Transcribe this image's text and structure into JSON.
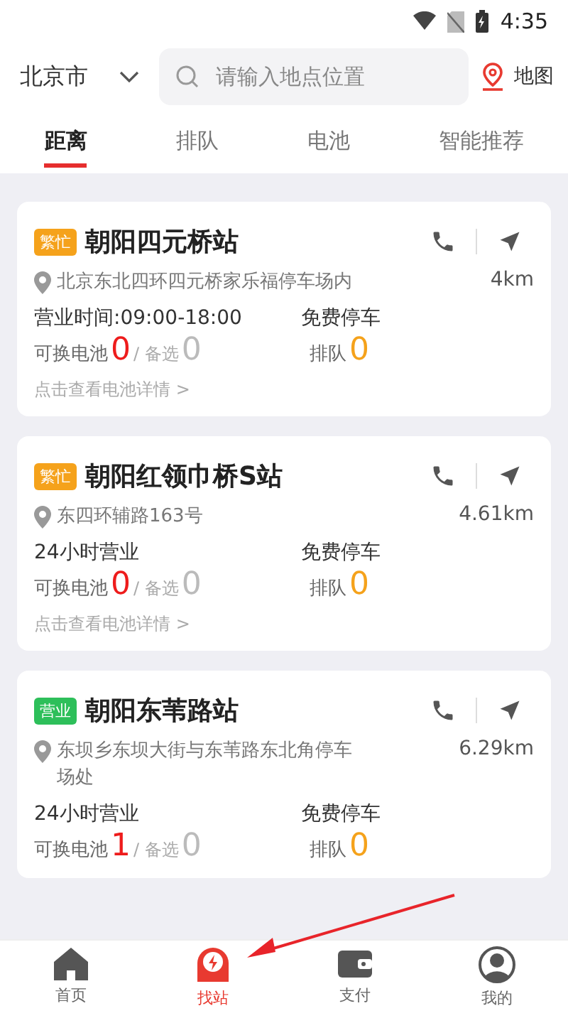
{
  "status_bar": {
    "time": "4:35"
  },
  "header": {
    "city": "北京市",
    "search": {
      "placeholder": "请输入地点位置"
    },
    "map_button": "地图"
  },
  "tabs": [
    {
      "label": "距离",
      "selected": true
    },
    {
      "label": "排队",
      "selected": false
    },
    {
      "label": "电池",
      "selected": false
    },
    {
      "label": "智能推荐",
      "selected": false
    }
  ],
  "stations": [
    {
      "badge": {
        "label": "繁忙",
        "color": "#f5a21b"
      },
      "name": "朝阳四元桥站",
      "address": "北京东北四环四元桥家乐福停车场内",
      "distance": "4km",
      "hours": "营业时间:09:00-18:00",
      "parking": "免费停车",
      "battery_label": "可换电池",
      "battery_count": "0",
      "spare_label": "/ 备选",
      "spare_count": "0",
      "queue_label": "排队",
      "queue_count": "0",
      "details_link": "点击查看电池详情 >"
    },
    {
      "badge": {
        "label": "繁忙",
        "color": "#f5a21b"
      },
      "name": "朝阳红领巾桥S站",
      "address": "东四环辅路163号",
      "distance": "4.61km",
      "hours": "24小时营业",
      "parking": "免费停车",
      "battery_label": "可换电池",
      "battery_count": "0",
      "spare_label": "/ 备选",
      "spare_count": "0",
      "queue_label": "排队",
      "queue_count": "0",
      "details_link": "点击查看电池详情 >"
    },
    {
      "badge": {
        "label": "营业",
        "color": "#2dbf5a"
      },
      "name": "朝阳东苇路站",
      "address": "东坝乡东坝大街与东苇路东北角停车场处",
      "distance": "6.29km",
      "hours": "24小时营业",
      "parking": "免费停车",
      "battery_label": "可换电池",
      "battery_count": "1",
      "spare_label": "/ 备选",
      "spare_count": "0",
      "queue_label": "排队",
      "queue_count": "0"
    }
  ],
  "bottom_nav": [
    {
      "label": "首页",
      "kind": "home",
      "selected": false
    },
    {
      "label": "找站",
      "kind": "station",
      "selected": true
    },
    {
      "label": "支付",
      "kind": "wallet",
      "selected": false
    },
    {
      "label": "我的",
      "kind": "profile",
      "selected": false
    }
  ]
}
